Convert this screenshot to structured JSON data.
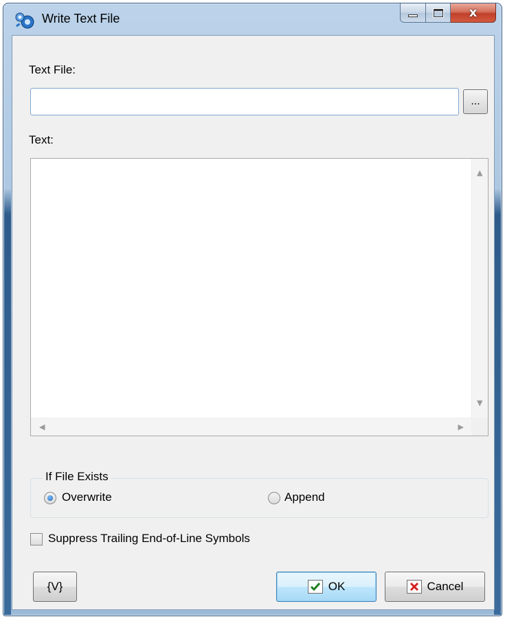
{
  "window": {
    "title": "Write Text File",
    "close_glyph": "x"
  },
  "form": {
    "text_file_label": "Text File:",
    "text_file_value": "",
    "browse_label": "...",
    "text_label": "Text:",
    "text_value": "",
    "if_file_exists": {
      "caption": "If File Exists",
      "options": [
        {
          "label": "Overwrite",
          "selected": true
        },
        {
          "label": "Append",
          "selected": false
        }
      ]
    },
    "suppress_label": "Suppress Trailing End-of-Line Symbols",
    "suppress_checked": false
  },
  "buttons": {
    "variables_label": "{V}",
    "ok_label": "OK",
    "cancel_label": "Cancel"
  },
  "icons": {
    "ok": "check-icon",
    "cancel": "x-icon",
    "app": "gears-icon"
  },
  "colors": {
    "ok_check": "#1e7f1e",
    "cancel_x": "#d42020",
    "radio_selected": "#1a5fb4"
  }
}
